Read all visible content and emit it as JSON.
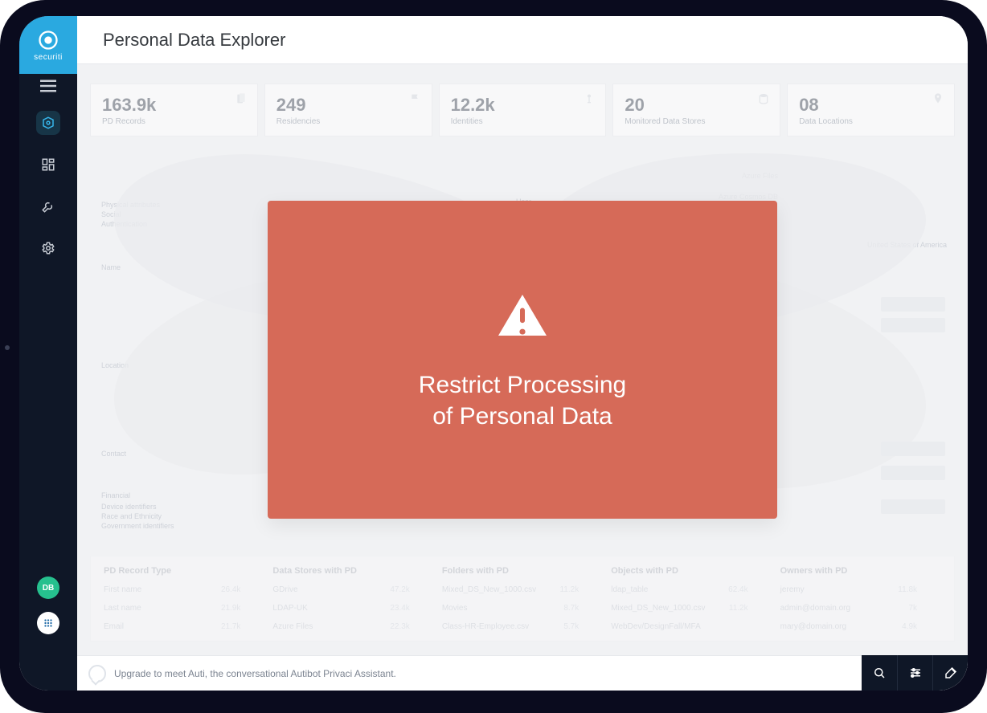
{
  "brand": {
    "name": "securiti"
  },
  "page": {
    "title": "Personal Data Explorer"
  },
  "sidebar": {
    "avatar_initials": "DB",
    "items": []
  },
  "kpis": [
    {
      "value": "163.9k",
      "label": "PD Records"
    },
    {
      "value": "249",
      "label": "Residencies"
    },
    {
      "value": "12.2k",
      "label": "Identities"
    },
    {
      "value": "20",
      "label": "Monitored Data Stores"
    },
    {
      "value": "08",
      "label": "Data Locations"
    }
  ],
  "sankey": {
    "left_categories": [
      "Physical attributes",
      "Social",
      "Authentication",
      "Name",
      "Location",
      "Contact",
      "Financial",
      "Device identifiers",
      "Race and Ethnicity",
      "Government identifiers"
    ],
    "middle_label": "User",
    "right_top": [
      "Azure Files",
      "Azure Cosmos DB"
    ],
    "right_labels": [
      "United States of America",
      "",
      "",
      ""
    ]
  },
  "table": {
    "headers": [
      "PD Record Type",
      "Data Stores with PD",
      "Folders with PD",
      "Objects with PD",
      "Owners with PD"
    ],
    "rows": [
      {
        "c0": {
          "t": "First name",
          "v": "26.4k"
        },
        "c1": {
          "t": "GDrive",
          "v": "47.2k"
        },
        "c2": {
          "t": "Mixed_DS_New_1000.csv",
          "v": "11.2k"
        },
        "c3": {
          "t": "ldap_table",
          "v": "62.4k"
        },
        "c4": {
          "t": "jeremy",
          "v": "11.8k"
        }
      },
      {
        "c0": {
          "t": "Last name",
          "v": "21.9k"
        },
        "c1": {
          "t": "LDAP-UK",
          "v": "23.4k"
        },
        "c2": {
          "t": "Movies",
          "v": "8.7k"
        },
        "c3": {
          "t": "Mixed_DS_New_1000.csv",
          "v": "11.2k"
        },
        "c4": {
          "t": "admin@domain.org",
          "v": "7k"
        }
      },
      {
        "c0": {
          "t": "Email",
          "v": "21.7k"
        },
        "c1": {
          "t": "Azure Files",
          "v": "22.3k"
        },
        "c2": {
          "t": "Class-HR-Employee.csv",
          "v": "5.7k"
        },
        "c3": {
          "t": "WebDev/DesignFall/MFA",
          "v": ""
        },
        "c4": {
          "t": "mary@domain.org",
          "v": "4.9k"
        }
      }
    ]
  },
  "assistant_bar": {
    "text": "Upgrade to meet Auti, the conversational Autibot Privaci Assistant."
  },
  "modal": {
    "line1": "Restrict Processing",
    "line2": "of Personal Data"
  },
  "colors": {
    "brand": "#2aa9e0",
    "sidebar": "#0f1727",
    "modal": "#d66a58"
  }
}
